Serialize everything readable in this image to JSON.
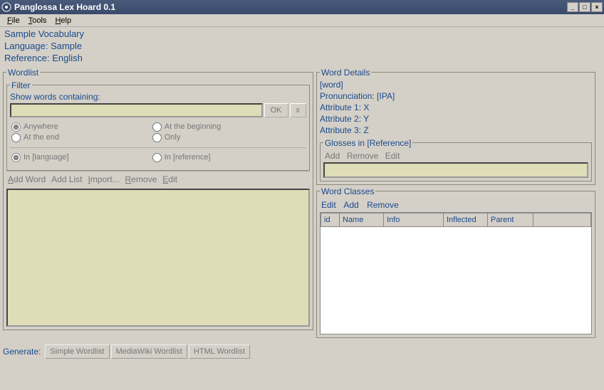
{
  "window": {
    "title": "Panglossa Lex Hoard 0.1",
    "controls": {
      "minimize": "_",
      "maximize": "□",
      "close": "×"
    }
  },
  "menubar": {
    "file": "File",
    "file_u": "F",
    "tools": "Tools",
    "tools_u": "T",
    "help": "Help",
    "help_u": "H"
  },
  "info": {
    "vocab": "Sample Vocabulary",
    "language": "Language: Sample",
    "reference": "Reference: English"
  },
  "wordlist": {
    "legend": "Wordlist",
    "filter_legend": "Filter",
    "show_label": "Show words containing:",
    "ok": "OK",
    "clear": "x",
    "radios": {
      "anywhere": "Anywhere",
      "beginning": "At the beginning",
      "end": "At the end",
      "only": "Only"
    },
    "lang_radios": {
      "in_language": "In [language]",
      "in_reference": "In [reference]"
    },
    "toolbar": {
      "add_word": "Add Word",
      "add_word_u": "A",
      "add_list": "Add List",
      "import": "Import...",
      "import_u": "I",
      "remove": "Remove",
      "remove_u": "R",
      "edit": "Edit",
      "edit_u": "E"
    }
  },
  "details": {
    "legend": "Word Details",
    "word": "[word]",
    "pronunciation": "Pronunciation: [IPA]",
    "attr1": "Attribute 1: X",
    "attr2": "Attribute 2: Y",
    "attr3": "Attribute 3: Z"
  },
  "glosses": {
    "legend": "Glosses in [Reference]",
    "add": "Add",
    "remove": "Remove",
    "edit": "Edit"
  },
  "wordclasses": {
    "legend": "Word Classes",
    "edit": "Edit",
    "add": "Add",
    "remove": "Remove",
    "cols": {
      "id": "id",
      "name": "Name",
      "info": "Info",
      "inflected": "Inflected",
      "parent": "Parent"
    }
  },
  "generate": {
    "label": "Generate:",
    "simple": "Simple Wordlist",
    "mediawiki": "MediaWiki Wordlist",
    "html": "HTML Wordlist"
  }
}
